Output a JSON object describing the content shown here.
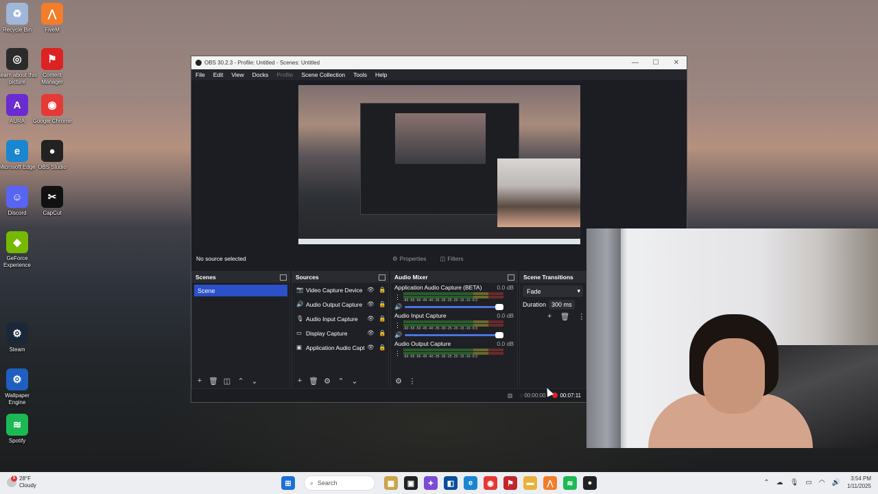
{
  "desktop_icons": [
    {
      "label": "Recycle Bin",
      "icon": "recycle-bin-icon",
      "color": "#9fb7d8",
      "glyph": "♻"
    },
    {
      "label": "FiveM",
      "icon": "fivem-icon",
      "color": "#f27d2a",
      "glyph": "⋀"
    },
    {
      "label": "Learn about this picture",
      "icon": "camera-icon",
      "color": "#2b2b2b",
      "glyph": "◎"
    },
    {
      "label": "Content Manager",
      "icon": "content-manager-icon",
      "color": "#d22",
      "glyph": "⚑"
    },
    {
      "label": "AURA",
      "icon": "aura-icon",
      "color": "#6a2bd0",
      "glyph": "A"
    },
    {
      "label": "Google Chrome",
      "icon": "chrome-icon",
      "color": "#e53935",
      "glyph": "◉"
    },
    {
      "label": "Microsoft Edge",
      "icon": "edge-icon",
      "color": "#1a86d0",
      "glyph": "e"
    },
    {
      "label": "OBS Studio",
      "icon": "obs-icon",
      "color": "#222",
      "glyph": "●"
    },
    {
      "label": "Discord",
      "icon": "discord-icon",
      "color": "#5865f2",
      "glyph": "☺"
    },
    {
      "label": "CapCut",
      "icon": "capcut-icon",
      "color": "#111",
      "glyph": "✂"
    },
    {
      "label": "GeForce Experience",
      "icon": "geforce-icon",
      "color": "#76b900",
      "glyph": "◆"
    },
    {
      "label": "Steam",
      "icon": "steam-icon",
      "color": "#1b2838",
      "glyph": "⚙"
    },
    {
      "label": "Wallpaper Engine",
      "icon": "wallpaper-engine-icon",
      "color": "#1f5fbf",
      "glyph": "⚙"
    },
    {
      "label": "Spotify",
      "icon": "spotify-icon",
      "color": "#1db954",
      "glyph": "≋"
    }
  ],
  "obs": {
    "title": "OBS 30.2.3 - Profile: Untitled - Scenes: Untitled",
    "menu": [
      "File",
      "Edit",
      "View",
      "Docks",
      "Profile",
      "Scene Collection",
      "Tools",
      "Help"
    ],
    "source_bar": {
      "status": "No source selected",
      "properties": "Properties",
      "filters": "Filters"
    },
    "scenes": {
      "header": "Scenes",
      "items": [
        "Scene"
      ]
    },
    "sources": {
      "header": "Sources",
      "items": [
        {
          "name": "Video Capture Device",
          "icon": "camera-icon"
        },
        {
          "name": "Audio Output Capture",
          "icon": "speaker-icon"
        },
        {
          "name": "Audio Input Capture",
          "icon": "microphone-icon"
        },
        {
          "name": "Display Capture",
          "icon": "monitor-icon"
        },
        {
          "name": "Application Audio Capture (BETA)",
          "icon": "app-audio-icon"
        }
      ]
    },
    "mixer": {
      "header": "Audio Mixer",
      "channels": [
        {
          "name": "Application Audio Capture (BETA)",
          "db": "0.0 dB"
        },
        {
          "name": "Audio Input Capture",
          "db": "0.0 dB"
        },
        {
          "name": "Audio Output Capture",
          "db": "0.0 dB"
        }
      ],
      "ticks": "-60 -55 -50 -45 -40 -35 -30 -25 -20 -15 -10 -5 0"
    },
    "transitions": {
      "header": "Scene Transitions",
      "type": "Fade",
      "duration_label": "Duration",
      "duration": "300 ms"
    },
    "status": {
      "stream_time": "00:00:00",
      "rec_time": "00:07:11"
    }
  },
  "taskbar": {
    "weather_temp": "28°F",
    "weather_desc": "Cloudy",
    "weather_badge": "5",
    "search_placeholder": "Search",
    "time": "3:54 PM",
    "date": "1/11/2025"
  }
}
